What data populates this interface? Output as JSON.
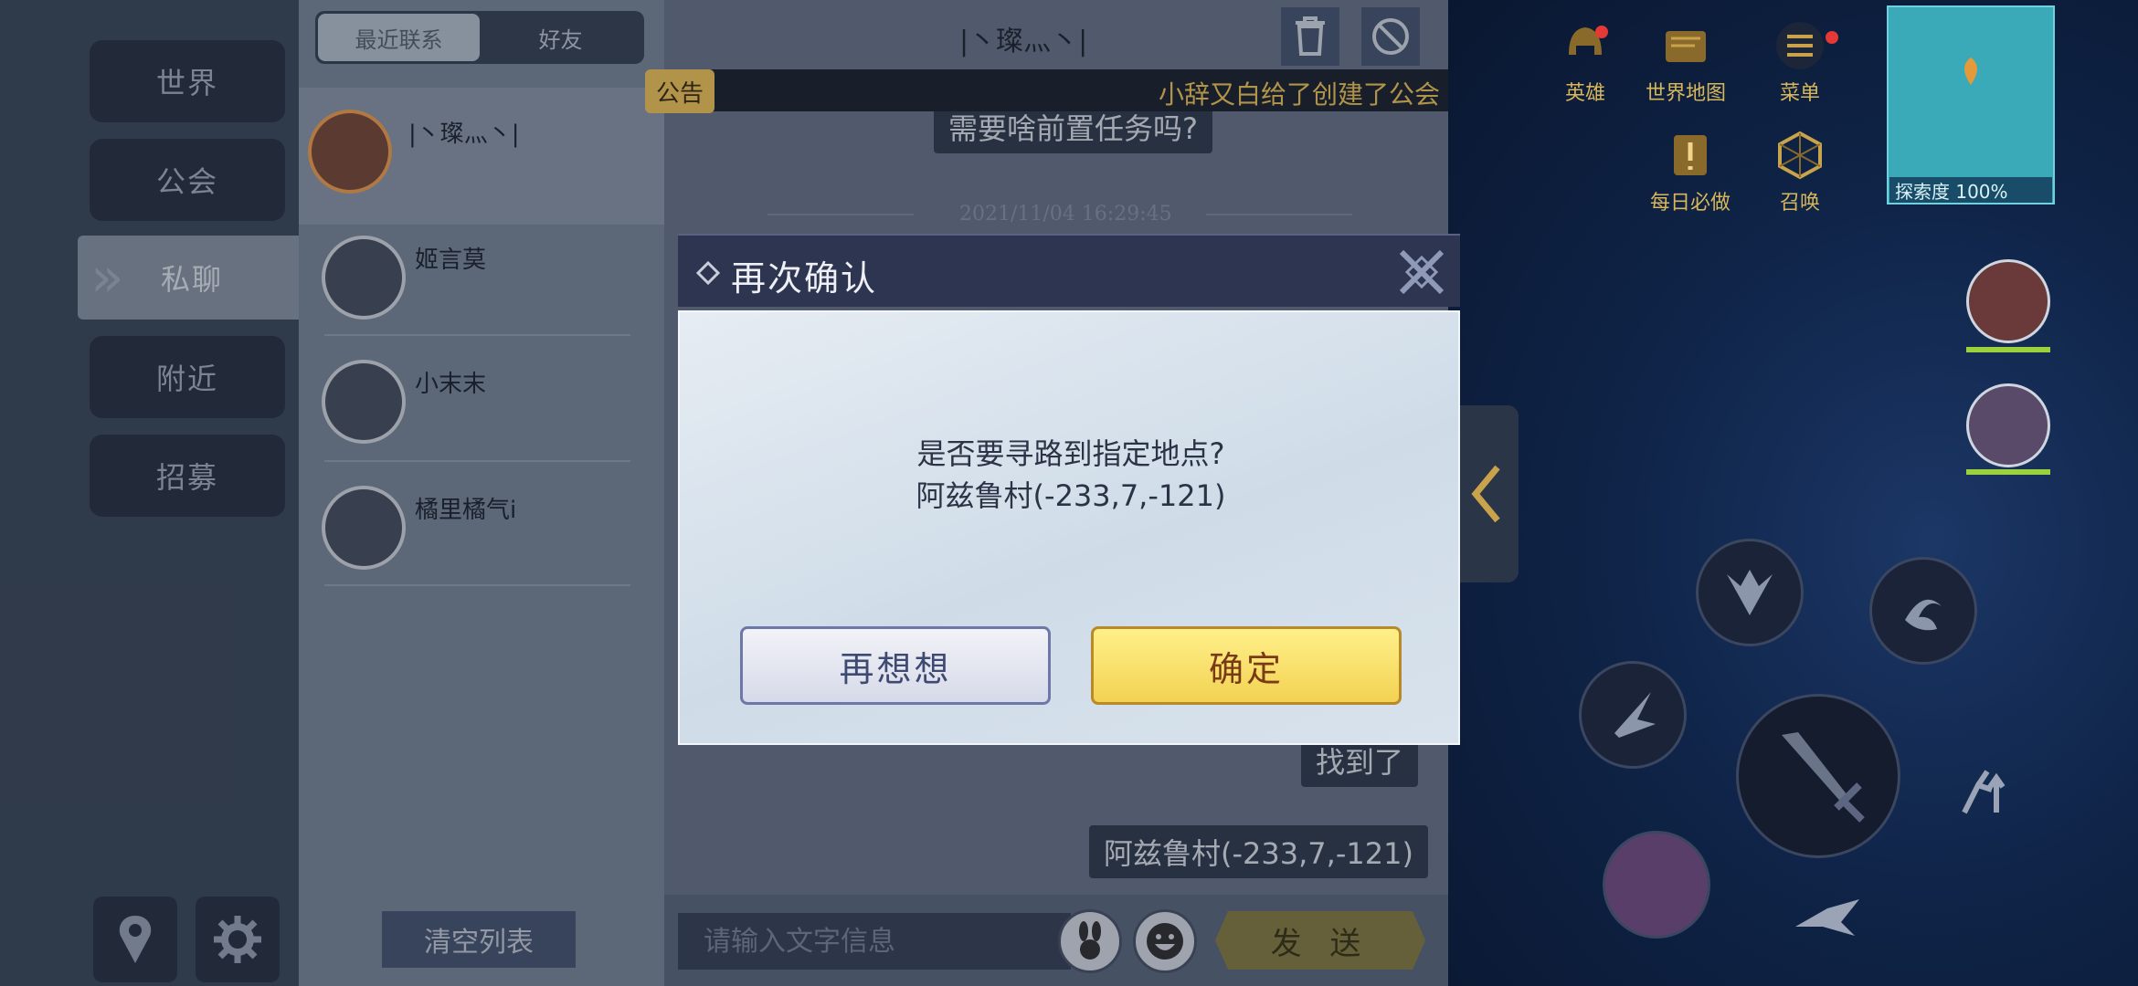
{
  "nav": {
    "items": [
      {
        "label": "世界"
      },
      {
        "label": "公会"
      },
      {
        "label": "私聊"
      },
      {
        "label": "附近"
      },
      {
        "label": "招募"
      }
    ]
  },
  "friend_panel": {
    "tabs": [
      {
        "label": "最近联系"
      },
      {
        "label": "好友"
      }
    ],
    "friends": [
      {
        "name": "|丶璨灬丶|"
      },
      {
        "name": "姬言莫"
      },
      {
        "name": "小末末"
      },
      {
        "name": "橘里橘气i"
      }
    ],
    "clear_label": "清空列表"
  },
  "chat": {
    "title": "|丶璨灬丶|",
    "announcement_tag": "公告",
    "announcement_text": "小辞又白给了创建了公会",
    "bubble_top": "需要啥前置任务吗?",
    "timestamp": "2021/11/04 16:29:45",
    "bubble_found": "找到了",
    "bubble_location": "阿兹鲁村(-233,7,-121)",
    "input_placeholder": "请输入文字信息",
    "send_label": "发 送"
  },
  "hud": {
    "icons": [
      {
        "label": "英雄"
      },
      {
        "label": "世界地图"
      },
      {
        "label": "菜单"
      },
      {
        "label": "每日必做"
      },
      {
        "label": "召唤"
      }
    ],
    "explore_label": "探索度 100%"
  },
  "modal": {
    "title": "再次确认",
    "message_line1": "是否要寻路到指定地点?",
    "message_line2": "阿兹鲁村(-233,7,-121)",
    "cancel_label": "再想想",
    "confirm_label": "确定"
  },
  "colors": {
    "accent_gold": "#f2c65a",
    "confirm_yellow": "#f2d252",
    "panel_dark": "#2e3550"
  }
}
